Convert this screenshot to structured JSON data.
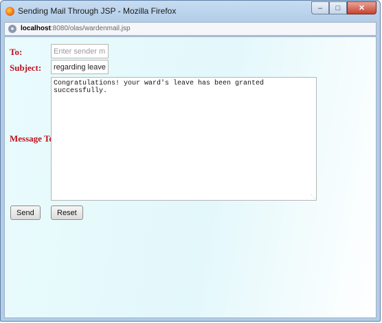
{
  "window": {
    "title": "Sending Mail Through JSP - Mozilla Firefox",
    "minimize_glyph": "–",
    "maximize_glyph": "□",
    "close_glyph": "✕"
  },
  "urlbar": {
    "host": "localhost",
    "rest": ":8080/olas/wardenmail.jsp",
    "site_icon_glyph": "●"
  },
  "form": {
    "to_label": "To:",
    "to_placeholder": "Enter sender mail-id",
    "to_value": "",
    "subject_label": "Subject:",
    "subject_value": "regarding leave",
    "message_label": "Message Text:",
    "message_value": "Congratulations! your ward's leave has been granted successfully.",
    "send_label": "Send",
    "reset_label": "Reset"
  },
  "colors": {
    "label_red": "#c0101f",
    "page_bg": "#e3f8fb",
    "close_button": "#c8432e"
  },
  "icons": {
    "app": "firefox-icon",
    "site": "globe-icon",
    "resize": "resize-grip-icon"
  }
}
